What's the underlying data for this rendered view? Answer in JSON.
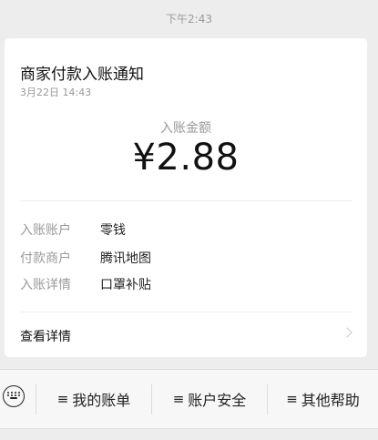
{
  "timestamp": "下午2:43",
  "card": {
    "title": "商家付款入账通知",
    "time": "3月22日 14:43",
    "amount_label": "入账金额",
    "amount": "¥2.88",
    "details": [
      {
        "key": "入账账户",
        "value": "零钱"
      },
      {
        "key": "付款商户",
        "value": "腾讯地图"
      },
      {
        "key": "入账详情",
        "value": "口罩补贴"
      }
    ],
    "view_details_label": "查看详情"
  },
  "menu": {
    "keyboard_icon": "keyboard-icon",
    "items": [
      {
        "label": "我的账单"
      },
      {
        "label": "账户安全"
      },
      {
        "label": "其他帮助"
      }
    ],
    "item_prefix": "≡"
  },
  "colors": {
    "background": "#ededed",
    "card": "#ffffff",
    "muted_text": "#999999",
    "primary_text": "#111111"
  }
}
